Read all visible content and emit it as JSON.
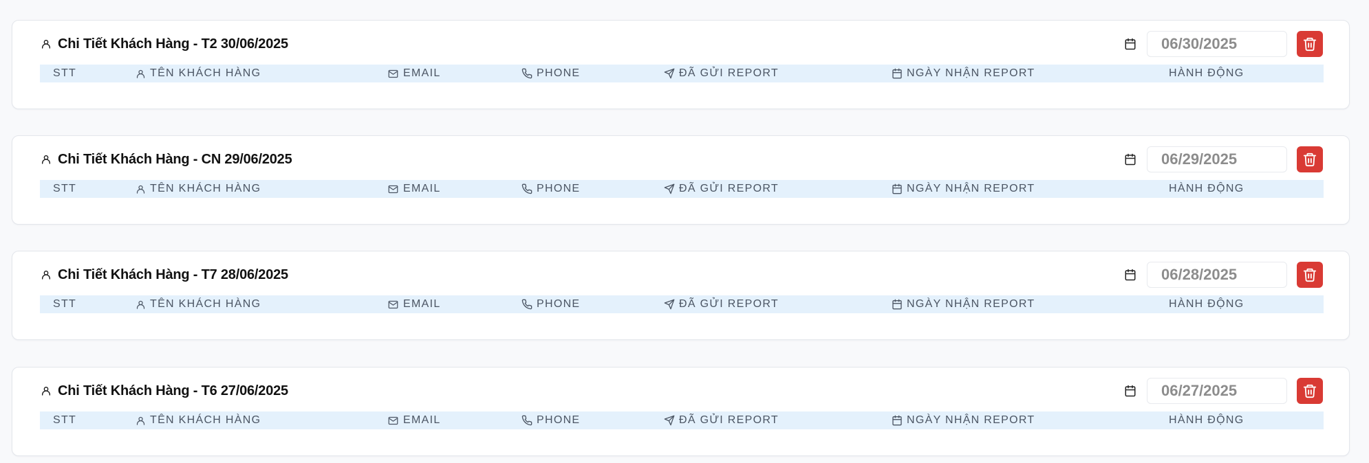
{
  "columns": {
    "stt": "STT",
    "name": "TÊN KHÁCH HÀNG",
    "email": "EMAIL",
    "phone": "PHONE",
    "sent": "ĐÃ GỬI REPORT",
    "received": "NGÀY NHẬN REPORT",
    "action": "HÀNH ĐỘNG"
  },
  "icons": {
    "title": "user-icon",
    "date": "calendar-icon",
    "delete": "trash-icon",
    "name_col": "user-icon",
    "email_col": "mail-icon",
    "phone_col": "phone-icon",
    "sent_col": "send-icon",
    "received_col": "calendar-icon"
  },
  "colors": {
    "delete_button": "#d93a34",
    "table_header_bg": "#e4f1fc",
    "date_text": "#8c8c8c"
  },
  "cards": [
    {
      "title": "Chi Tiết Khách Hàng - T2 30/06/2025",
      "date_value": "06/30/2025"
    },
    {
      "title": "Chi Tiết Khách Hàng - CN 29/06/2025",
      "date_value": "06/29/2025"
    },
    {
      "title": "Chi Tiết Khách Hàng - T7 28/06/2025",
      "date_value": "06/28/2025"
    },
    {
      "title": "Chi Tiết Khách Hàng - T6 27/06/2025",
      "date_value": "06/27/2025"
    }
  ]
}
